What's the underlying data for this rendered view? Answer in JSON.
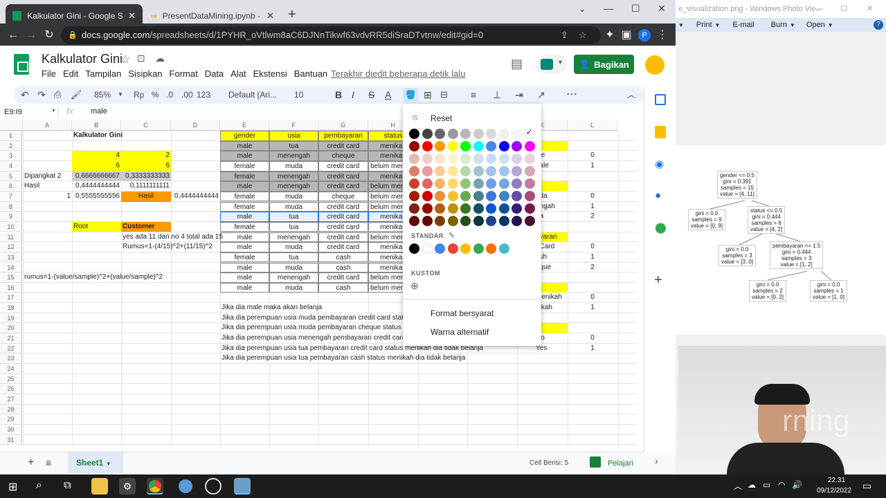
{
  "browser": {
    "tabs": [
      {
        "title": "Kalkulator Gini - Google Spreads",
        "active": true
      },
      {
        "title": "PresentDataMining.ipynb - Cola",
        "active": false
      }
    ],
    "url_domain": "docs.google.com",
    "url_path": "/spreadsheets/d/1PYHR_oVtlwm8aC6DJNnTikwf63vdvRR5diSraDTvtnw/edit#gid=0",
    "profile_initial": "P"
  },
  "sheets": {
    "title": "Kalkulator Gini",
    "menu": [
      "File",
      "Edit",
      "Tampilan",
      "Sisipkan",
      "Format",
      "Data",
      "Alat",
      "Ekstensi",
      "Bantuan"
    ],
    "last_edit": "Terakhir diedit beberapa detik lalu",
    "share_label": "Bagikan",
    "toolbar": {
      "zoom": "85%",
      "currency": "Rp",
      "percent": "%",
      "dec_less": ".0",
      "dec_more": ".00",
      "num_format": "123",
      "font": "Default (Ari...",
      "font_size": "10",
      "bold": "B",
      "italic": "I",
      "strike": "S",
      "text_color": "A"
    },
    "namebox": "E9:I9",
    "fx": "fx",
    "formula_value": "male",
    "columns": [
      "A",
      "B",
      "C",
      "D",
      "E",
      "F",
      "G",
      "H",
      "K",
      "L"
    ],
    "rows": [
      "1",
      "2",
      "3",
      "4",
      "5",
      "6",
      "7",
      "8",
      "9",
      "10",
      "11",
      "12",
      "13",
      "14",
      "15",
      "16",
      "17",
      "18",
      "19",
      "20",
      "21",
      "22",
      "23",
      "24",
      "25",
      "26",
      "27",
      "28",
      "29",
      "30",
      "31"
    ],
    "cells": {
      "B1": "Kalkulator Gini",
      "B3": "4",
      "C3": "2",
      "B4": "6",
      "C4": "6",
      "A5": "Dipangkat 2",
      "B5": "0,6666666667",
      "C5": "0,3333333333",
      "A6": "Hasil",
      "B6": "0,4444444444",
      "C6": "0,1111111111",
      "A7": "1",
      "B7": "0,5555555556",
      "C7": "Hasil",
      "D7": "0,4444444444",
      "B10": "Root",
      "C10": "Customer",
      "C11": "yes ada 11 dan no 4 total ada 15",
      "C12": "Rumus=1-(4/15)^2+(11/15)^2",
      "A15": "rumus=1-(value/sample)^2+(value/sample)^2",
      "E18": "Jika dia male maka akan belanja",
      "E19": "Jika dia perempuan usia muda pembayaran credit card status",
      "E20": "Jika dia perempuan usia muda pembayaran cheque status bel",
      "E21": "Jika dia perempuan usia menengah pembayaran credit card st",
      "E22": "Jika dia perempuan usia tua pembayaran credit card status menikah dia tidak belanja",
      "E23": "Jika dia perempuan usia tua pembayaran cash status menikah dia tidak belanja"
    },
    "table_headers": [
      "gender",
      "usia",
      "pembayaran",
      "status"
    ],
    "table_rows": [
      [
        "male",
        "tua",
        "credit card",
        "menikah"
      ],
      [
        "male",
        "menengah",
        "cheque",
        "menikah"
      ],
      [
        "female",
        "muda",
        "credit card",
        "belum menikah"
      ],
      [
        "female",
        "menengah",
        "credit card",
        "menikah"
      ],
      [
        "male",
        "menengah",
        "credit card",
        "belum menikah"
      ],
      [
        "female",
        "muda",
        "cheque",
        "belum menikah"
      ],
      [
        "female",
        "muda",
        "credit card",
        "belum menikah"
      ],
      [
        "male",
        "tua",
        "credit card",
        "menikah"
      ],
      [
        "female",
        "tua",
        "credit card",
        "menikah"
      ],
      [
        "male",
        "menengah",
        "credit card",
        "belum menikah"
      ],
      [
        "male",
        "muda",
        "credit card",
        "menikah"
      ],
      [
        "female",
        "tua",
        "cash",
        "menikah"
      ],
      [
        "male",
        "muda",
        "cash",
        "menikah"
      ],
      [
        "male",
        "menengah",
        "credit card",
        "belum menikah"
      ],
      [
        "male",
        "muda",
        "cash",
        "belum menikah"
      ]
    ],
    "right_cells": {
      "K3": "ale",
      "L3": "0",
      "K4": "nale",
      "L4": "1",
      "K7": "uda",
      "L7": "0",
      "K8": "engah",
      "L8": "1",
      "K9": "ua",
      "L9": "2",
      "K11": "ayaran",
      "K12": "t Card",
      "L12": "0",
      "K13": "ash",
      "L13": "1",
      "K14": "eque",
      "L14": "2",
      "K17": "Menikah",
      "L17": "0",
      "K18": "nikah",
      "L18": "1",
      "K20": "er",
      "K21": "No",
      "L21": "0",
      "K22": "Yes",
      "L22": "1"
    },
    "sheet_tab": "Sheet1",
    "cell_count": "Cell Berisi: 5",
    "learn": "Pelajari"
  },
  "color_picker": {
    "reset": "Reset",
    "standard_label": "STANDAR",
    "custom_label": "KUSTOM",
    "conditional": "Format bersyarat",
    "alternating": "Warna alternatif",
    "grays": [
      "#000000",
      "#434343",
      "#666666",
      "#999999",
      "#b7b7b7",
      "#cccccc",
      "#d9d9d9",
      "#efefef",
      "#f3f3f3",
      "#ffffff"
    ],
    "brights": [
      "#980000",
      "#ff0000",
      "#ff9900",
      "#ffff00",
      "#00ff00",
      "#00ffff",
      "#4a86e8",
      "#0000ff",
      "#9900ff",
      "#ff00ff"
    ],
    "shades": [
      [
        "#e6b8af",
        "#f4cccc",
        "#fce5cd",
        "#fff2cc",
        "#d9ead3",
        "#d0e0e3",
        "#c9daf8",
        "#cfe2f3",
        "#d9d2e9",
        "#ead1dc"
      ],
      [
        "#dd7e6b",
        "#ea9999",
        "#f9cb9c",
        "#ffe599",
        "#b6d7a8",
        "#a2c4c9",
        "#a4c2f4",
        "#9fc5e8",
        "#b4a7d6",
        "#d5a6bd"
      ],
      [
        "#cc4125",
        "#e06666",
        "#f6b26b",
        "#ffd966",
        "#93c47d",
        "#76a5af",
        "#6d9eeb",
        "#6fa8dc",
        "#8e7cc3",
        "#c27ba0"
      ],
      [
        "#a61c00",
        "#cc0000",
        "#e69138",
        "#f1c232",
        "#6aa84f",
        "#45818e",
        "#3c78d8",
        "#3d85c6",
        "#674ea7",
        "#a64d79"
      ],
      [
        "#85200c",
        "#990000",
        "#b45f06",
        "#bf9000",
        "#38761d",
        "#134f5c",
        "#1155cc",
        "#0b5394",
        "#351c75",
        "#741b47"
      ],
      [
        "#5b0f00",
        "#660000",
        "#783f04",
        "#7f6000",
        "#274e13",
        "#0c343d",
        "#1c4587",
        "#073763",
        "#20124d",
        "#4c1130"
      ]
    ],
    "standard": [
      "#000000",
      "#ffffff",
      "#4285f4",
      "#ea4335",
      "#fbbc04",
      "#34a853",
      "#ff6d01",
      "#46bdc6"
    ]
  },
  "photo_viewer": {
    "title": "e_visualization.png - Windows Photo Vie...",
    "menu": [
      "Print",
      "E-mail",
      "Burn",
      "Open"
    ],
    "nodes": [
      "gender <= 0.5\ngini = 0.391\nsamples = 15\nvalue = [4, 11]",
      "gini = 0.0\nsamples = 9\nvalue = [0, 9]",
      "status <= 0.5\ngini = 0.444\nsamples = 6\nvalue = [4, 2]",
      "gini = 0.0\nsamples = 3\nvalue = [3, 0]",
      "pembayaran <= 1.5\ngini = 0.444\nsamples = 3\nvalue = [1, 2]",
      "gini = 0.0\nsamples = 2\nvalue = [0, 2]",
      "gini = 0.0\nsamples = 1\nvalue = [1, 0]"
    ],
    "watermark": "rning"
  },
  "taskbar": {
    "time": "22.31",
    "date": "09/12/2022"
  }
}
